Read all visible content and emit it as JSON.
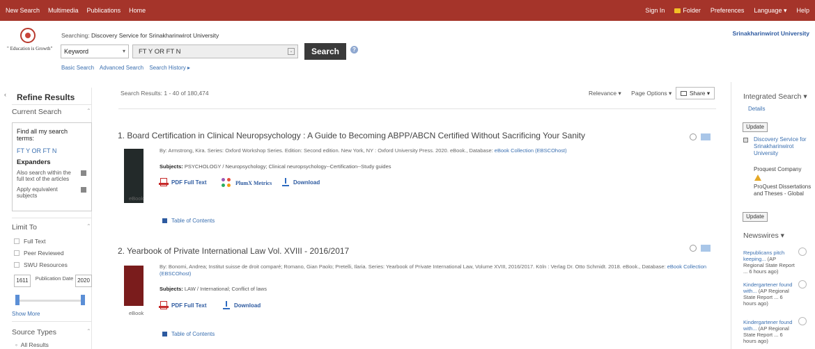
{
  "topnav": {
    "left": [
      "New Search",
      "Multimedia",
      "Publications",
      "Home"
    ],
    "right": [
      "Sign In",
      "Folder",
      "Preferences",
      "Language",
      "Help"
    ]
  },
  "logo": {
    "motto": "\" Education is Growth\""
  },
  "search": {
    "searching_prefix": "Searching:",
    "searching_db": "Discovery Service for Srinakharinwirot University",
    "field": "Keyword",
    "query": "FT Y OR FT N",
    "button": "Search",
    "links": [
      "Basic Search",
      "Advanced Search",
      "Search History ▸"
    ]
  },
  "institution": "Srinakharinwirot University",
  "sidebar": {
    "title": "Refine Results",
    "current_search": "Current Search",
    "find_all": "Find all my search terms:",
    "term": "FT Y OR FT N",
    "expanders": "Expanders",
    "exp1": "Also search within the full text of the articles",
    "exp2": "Apply equivalent subjects",
    "limit_to": "Limit To",
    "limits": [
      "Full Text",
      "Peer Reviewed",
      "SWU Resources"
    ],
    "date_from": "1611",
    "date_to": "2020",
    "date_label": "Publication Date",
    "show_more": "Show More",
    "source_types": "Source Types",
    "all_results": "All Results"
  },
  "results": {
    "count": "Search Results: 1 - 40 of 180,474",
    "relevance": "Relevance ▾",
    "page_options": "Page Options ▾",
    "share": "Share ▾",
    "items": [
      {
        "title": "1. Board Certification in Clinical Neuropsychology : A Guide to Becoming ABPP/ABCN Certified Without Sacrificing Your Sanity",
        "meta": "By: Armstrong, Kira. Series: Oxford Workshop Series. Edition: Second edition. New York, NY : Oxford University Press. 2020. eBook., Database: ",
        "db": "eBook Collection (EBSCOhost)",
        "subjects_label": "Subjects:",
        "subjects": "PSYCHOLOGY / Neuropsychology; Clinical neuropsychology--Certification--Study guides",
        "type": "eBook",
        "pdf": "PDF Full Text",
        "plumx": "PlumX Metrics",
        "download": "Download",
        "toc": "Table of Contents"
      },
      {
        "title": "2. Yearbook of Private International Law Vol. XVIII - 2016/2017",
        "meta": "By: Bonomi, Andrea; Institut suisse de droit comparé; Romano, Gian Paolo; Pretelli, Ilaria. Series: Yearbook of Private International Law, Volume XVIII, 2016/2017. Köln : Verlag Dr. Otto Schmidt. 2018. eBook., Database: ",
        "db": "eBook Collection (EBSCOhost)",
        "subjects_label": "Subjects:",
        "subjects": "LAW / International; Conflict of laws",
        "type": "eBook",
        "pdf": "PDF Full Text",
        "download": "Download",
        "toc": "Table of Contents"
      }
    ]
  },
  "rightcol": {
    "integrated": "Integrated Search ▾",
    "details": "Details",
    "update": "Update",
    "db1": "Discovery Service for Srinakharinwirot University",
    "db2": "Proquest Company",
    "db3": "ProQuest Dissertations and Theses - Global",
    "newswires": "Newswires ▾",
    "news": [
      {
        "headline": "Republicans pitch keeping...",
        "source": "(AP Regional State Report ... 6 hours ago)"
      },
      {
        "headline": "Kindergartener found with...",
        "source": "(AP Regional State Report ... 6 hours ago)"
      },
      {
        "headline": "Kindergartener found with...",
        "source": "(AP Regional State Report ... 6 hours ago)"
      }
    ]
  },
  "colors": {
    "topbar": "#a5342a",
    "link": "#3a6fb0",
    "search_button": "#3a3a3a"
  }
}
